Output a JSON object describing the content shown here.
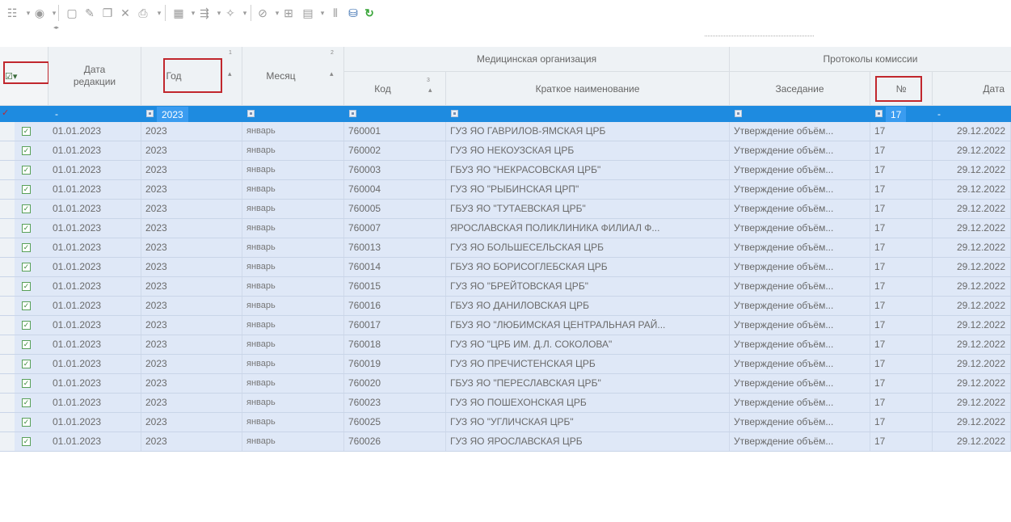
{
  "colors": {
    "filter_row": "#1e8be0",
    "row_bg": "#dfe8f7",
    "header_bg": "#eef2f5",
    "highlight_border": "#c1272d"
  },
  "toolbar": {
    "icons": [
      "list-dropdown-icon",
      "record-icon",
      "new-document-icon",
      "edit-pencil-icon",
      "copy-icon",
      "delete-x-icon",
      "print-icon",
      "table-view-icon",
      "export-icon",
      "pin-icon",
      "filter-icon",
      "tree-icon",
      "calculator-icon",
      "attach-icon",
      "archive-icon",
      "refresh-icon"
    ]
  },
  "header": {
    "select_all": "☑▾",
    "edit_date": "Дата\nредакции",
    "year": "Год",
    "year_sort_order": "1",
    "month": "Месяц",
    "month_sort_order": "2",
    "med_org_group": "Медицинская организация",
    "code": "Код",
    "code_sort_order": "3",
    "short_name": "Краткое наименование",
    "protocols_group": "Протоколы комиссии",
    "meeting": "Заседание",
    "number": "№",
    "date": "Дата"
  },
  "filters": {
    "edit_date": "-",
    "year": "2023",
    "number": "17",
    "date": "-"
  },
  "rows": [
    {
      "edit_date": "01.01.2023",
      "year": "2023",
      "month": "январь",
      "code": "760001",
      "name": "ГУЗ ЯО ГАВРИЛОВ-ЯМСКАЯ ЦРБ",
      "meeting": "Утверждение объём...",
      "number": "17",
      "date": "29.12.2022"
    },
    {
      "edit_date": "01.01.2023",
      "year": "2023",
      "month": "январь",
      "code": "760002",
      "name": "ГУЗ ЯО НЕКОУЗСКАЯ ЦРБ",
      "meeting": "Утверждение объём...",
      "number": "17",
      "date": "29.12.2022"
    },
    {
      "edit_date": "01.01.2023",
      "year": "2023",
      "month": "январь",
      "code": "760003",
      "name": "ГБУЗ ЯО \"НЕКРАСОВСКАЯ ЦРБ\"",
      "meeting": "Утверждение объём...",
      "number": "17",
      "date": "29.12.2022"
    },
    {
      "edit_date": "01.01.2023",
      "year": "2023",
      "month": "январь",
      "code": "760004",
      "name": "ГУЗ ЯО \"РЫБИНСКАЯ ЦРП\"",
      "meeting": "Утверждение объём...",
      "number": "17",
      "date": "29.12.2022"
    },
    {
      "edit_date": "01.01.2023",
      "year": "2023",
      "month": "январь",
      "code": "760005",
      "name": "ГБУЗ ЯО \"ТУТАЕВСКАЯ ЦРБ\"",
      "meeting": "Утверждение объём...",
      "number": "17",
      "date": "29.12.2022"
    },
    {
      "edit_date": "01.01.2023",
      "year": "2023",
      "month": "январь",
      "code": "760007",
      "name": "ЯРОСЛАВСКАЯ ПОЛИКЛИНИКА ФИЛИАЛ Ф...",
      "meeting": "Утверждение объём...",
      "number": "17",
      "date": "29.12.2022"
    },
    {
      "edit_date": "01.01.2023",
      "year": "2023",
      "month": "январь",
      "code": "760013",
      "name": "ГУЗ ЯО БОЛЬШЕСЕЛЬСКАЯ ЦРБ",
      "meeting": "Утверждение объём...",
      "number": "17",
      "date": "29.12.2022"
    },
    {
      "edit_date": "01.01.2023",
      "year": "2023",
      "month": "январь",
      "code": "760014",
      "name": "ГБУЗ ЯО БОРИСОГЛЕБСКАЯ ЦРБ",
      "meeting": "Утверждение объём...",
      "number": "17",
      "date": "29.12.2022"
    },
    {
      "edit_date": "01.01.2023",
      "year": "2023",
      "month": "январь",
      "code": "760015",
      "name": "ГУЗ ЯО \"БРЕЙТОВСКАЯ ЦРБ\"",
      "meeting": "Утверждение объём...",
      "number": "17",
      "date": "29.12.2022"
    },
    {
      "edit_date": "01.01.2023",
      "year": "2023",
      "month": "январь",
      "code": "760016",
      "name": "ГБУЗ ЯО ДАНИЛОВСКАЯ ЦРБ",
      "meeting": "Утверждение объём...",
      "number": "17",
      "date": "29.12.2022"
    },
    {
      "edit_date": "01.01.2023",
      "year": "2023",
      "month": "январь",
      "code": "760017",
      "name": "ГБУЗ ЯО \"ЛЮБИМСКАЯ ЦЕНТРАЛЬНАЯ РАЙ...",
      "meeting": "Утверждение объём...",
      "number": "17",
      "date": "29.12.2022"
    },
    {
      "edit_date": "01.01.2023",
      "year": "2023",
      "month": "январь",
      "code": "760018",
      "name": "ГУЗ ЯО \"ЦРБ ИМ. Д.Л. СОКОЛОВА\"",
      "meeting": "Утверждение объём...",
      "number": "17",
      "date": "29.12.2022"
    },
    {
      "edit_date": "01.01.2023",
      "year": "2023",
      "month": "январь",
      "code": "760019",
      "name": "ГУЗ ЯО ПРЕЧИСТЕНСКАЯ ЦРБ",
      "meeting": "Утверждение объём...",
      "number": "17",
      "date": "29.12.2022"
    },
    {
      "edit_date": "01.01.2023",
      "year": "2023",
      "month": "январь",
      "code": "760020",
      "name": "ГБУЗ ЯО \"ПЕРЕСЛАВСКАЯ ЦРБ\"",
      "meeting": "Утверждение объём...",
      "number": "17",
      "date": "29.12.2022"
    },
    {
      "edit_date": "01.01.2023",
      "year": "2023",
      "month": "январь",
      "code": "760023",
      "name": "ГУЗ ЯО ПОШЕХОНСКАЯ ЦРБ",
      "meeting": "Утверждение объём...",
      "number": "17",
      "date": "29.12.2022"
    },
    {
      "edit_date": "01.01.2023",
      "year": "2023",
      "month": "январь",
      "code": "760025",
      "name": "ГУЗ ЯО \"УГЛИЧСКАЯ ЦРБ\"",
      "meeting": "Утверждение объём...",
      "number": "17",
      "date": "29.12.2022"
    },
    {
      "edit_date": "01.01.2023",
      "year": "2023",
      "month": "январь",
      "code": "760026",
      "name": "ГУЗ ЯО ЯРОСЛАВСКАЯ ЦРБ",
      "meeting": "Утверждение объём...",
      "number": "17",
      "date": "29.12.2022"
    }
  ]
}
